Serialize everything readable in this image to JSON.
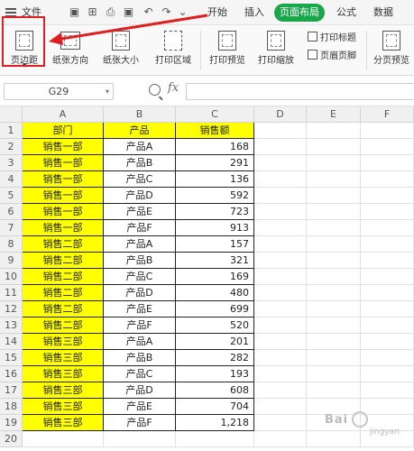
{
  "menubar": {
    "file": "文件",
    "tabs": [
      "开始",
      "插入",
      "页面布局",
      "公式",
      "数据"
    ],
    "active_tab": "页面布局"
  },
  "ribbon": {
    "margins": "页边距",
    "orientation": "纸张方向",
    "size": "纸张大小",
    "print_area": "打印区域",
    "print_preview": "打印预览",
    "print_scale": "打印缩放",
    "print_titles": "打印标题",
    "header_footer": "页眉页脚",
    "page_break_preview": "分页预览"
  },
  "formula_bar": {
    "cell_ref": "G29",
    "fx": "fx",
    "value": ""
  },
  "columns": [
    "A",
    "B",
    "C",
    "D",
    "E",
    "F"
  ],
  "rows": [
    {
      "n": "1",
      "a": "部门",
      "b": "产品",
      "c": "销售额"
    },
    {
      "n": "2",
      "a": "销售一部",
      "b": "产品A",
      "c": "168"
    },
    {
      "n": "3",
      "a": "销售一部",
      "b": "产品B",
      "c": "291"
    },
    {
      "n": "4",
      "a": "销售一部",
      "b": "产品C",
      "c": "136"
    },
    {
      "n": "5",
      "a": "销售一部",
      "b": "产品D",
      "c": "592"
    },
    {
      "n": "6",
      "a": "销售一部",
      "b": "产品E",
      "c": "723"
    },
    {
      "n": "7",
      "a": "销售一部",
      "b": "产品F",
      "c": "913"
    },
    {
      "n": "8",
      "a": "销售二部",
      "b": "产品A",
      "c": "157"
    },
    {
      "n": "9",
      "a": "销售二部",
      "b": "产品B",
      "c": "321"
    },
    {
      "n": "10",
      "a": "销售二部",
      "b": "产品C",
      "c": "169"
    },
    {
      "n": "11",
      "a": "销售二部",
      "b": "产品D",
      "c": "480"
    },
    {
      "n": "12",
      "a": "销售二部",
      "b": "产品E",
      "c": "699"
    },
    {
      "n": "13",
      "a": "销售二部",
      "b": "产品F",
      "c": "520"
    },
    {
      "n": "14",
      "a": "销售三部",
      "b": "产品A",
      "c": "201"
    },
    {
      "n": "15",
      "a": "销售三部",
      "b": "产品B",
      "c": "282"
    },
    {
      "n": "16",
      "a": "销售三部",
      "b": "产品C",
      "c": "193"
    },
    {
      "n": "17",
      "a": "销售三部",
      "b": "产品D",
      "c": "608"
    },
    {
      "n": "18",
      "a": "销售三部",
      "b": "产品E",
      "c": "704"
    },
    {
      "n": "19",
      "a": "销售三部",
      "b": "产品F",
      "c": "1,218"
    },
    {
      "n": "20",
      "a": "",
      "b": "",
      "c": ""
    }
  ],
  "colors": {
    "accent": "#1aa64a",
    "highlight_red": "#e02020",
    "dept_fill": "#ffff00"
  },
  "watermark": {
    "text": "Bai",
    "sub": "jingyan"
  }
}
